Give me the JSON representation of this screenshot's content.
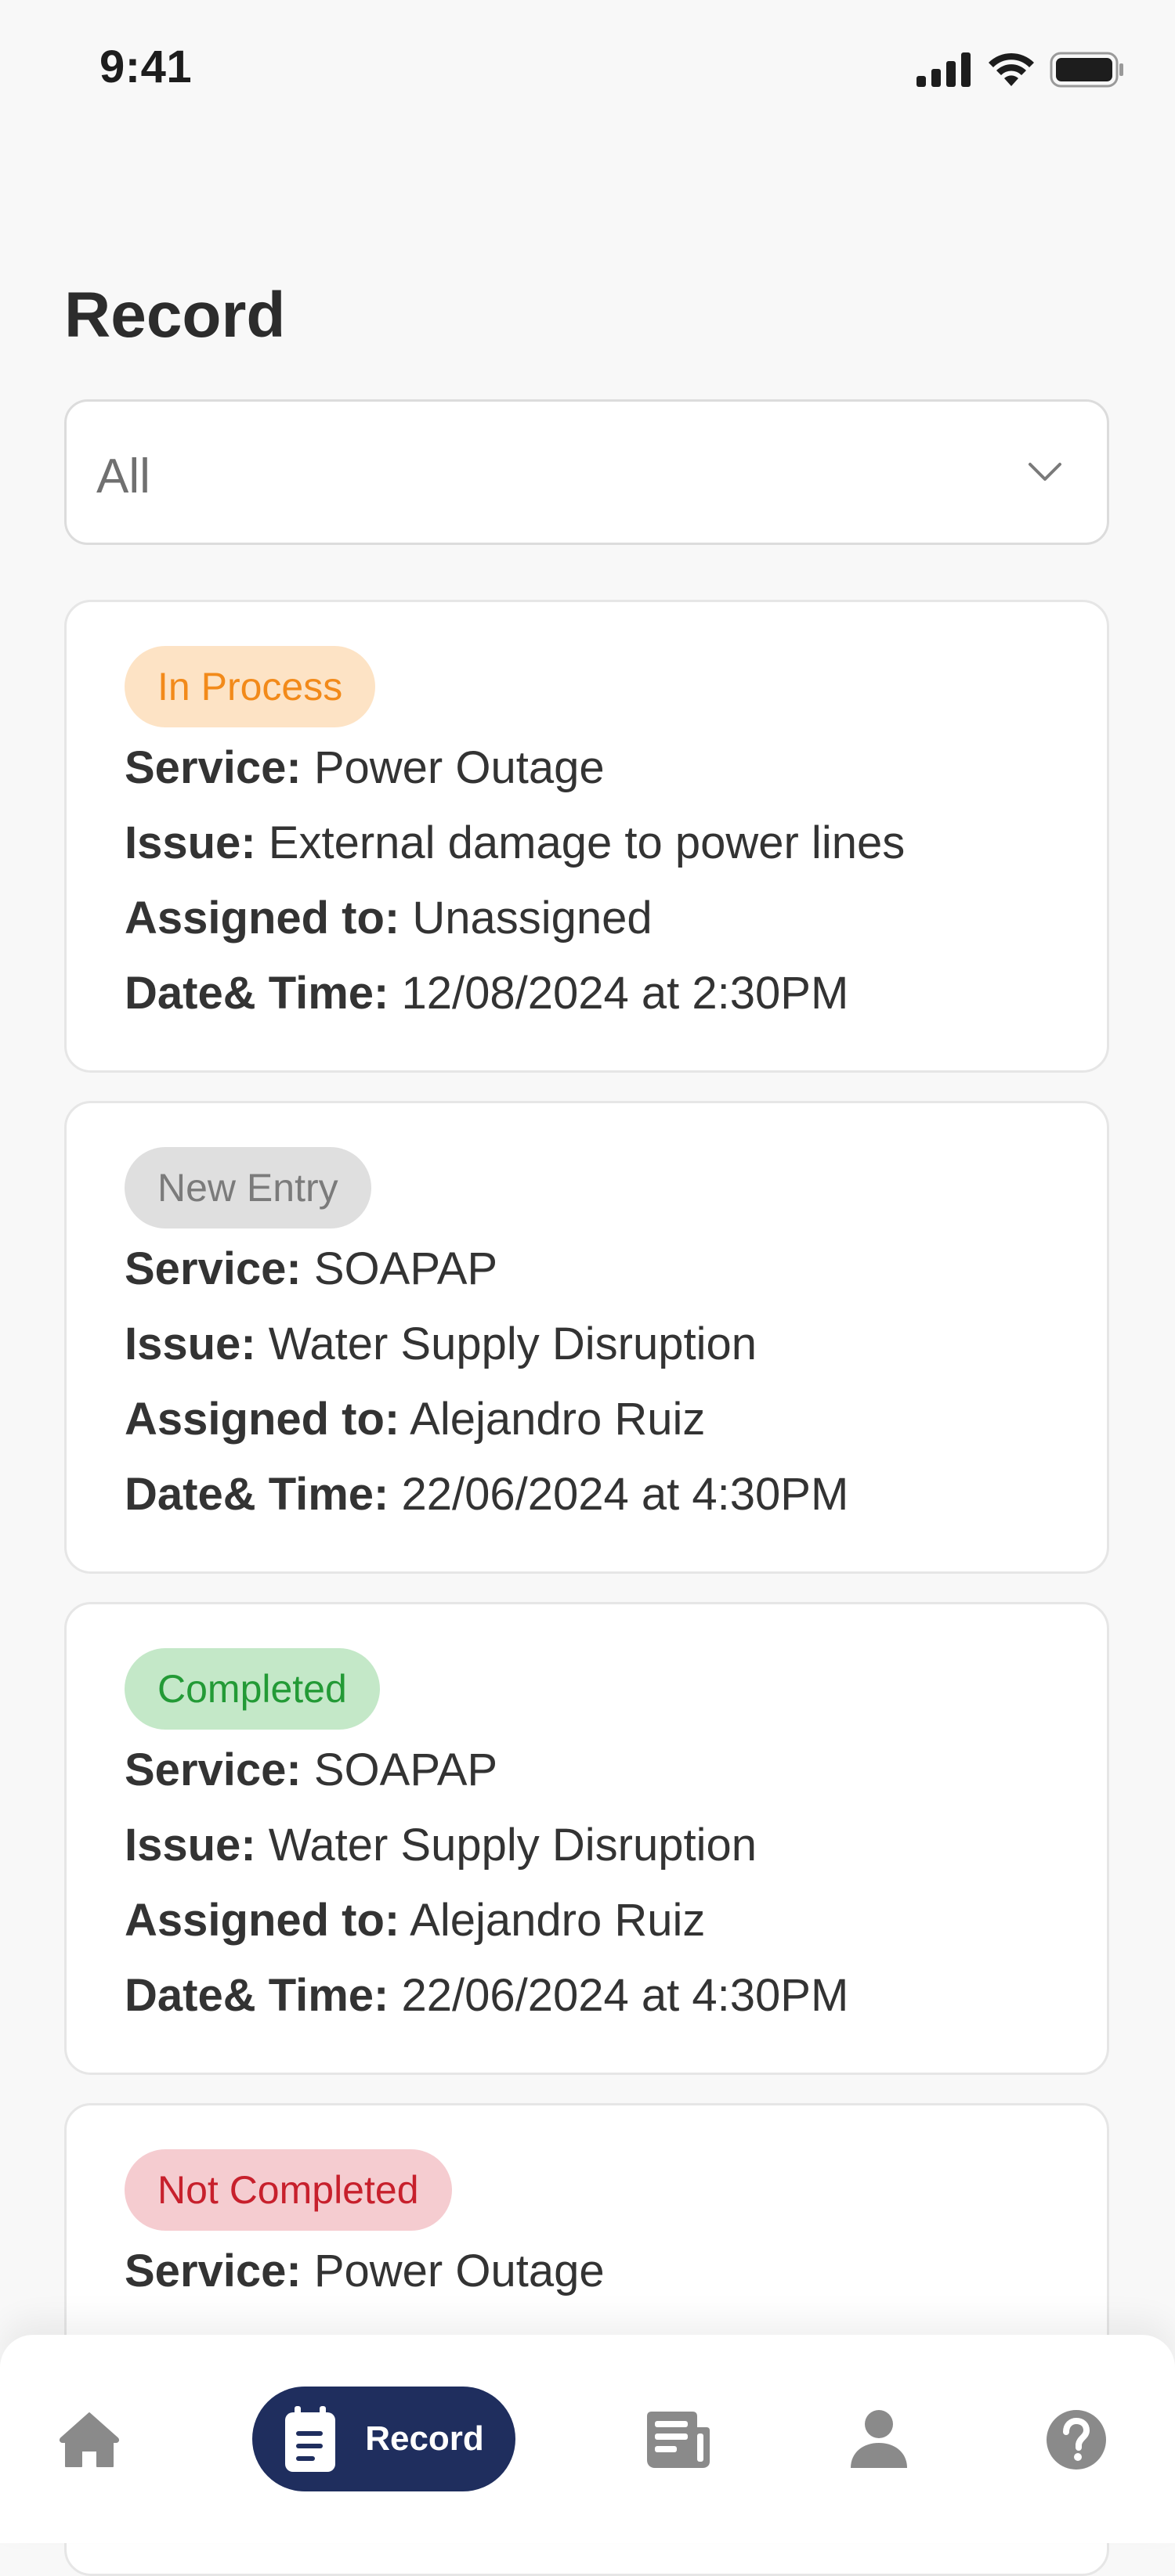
{
  "status_bar": {
    "time": "9:41"
  },
  "page": {
    "title": "Record"
  },
  "filter": {
    "selected": "All"
  },
  "records": [
    {
      "status": "In Process",
      "service_label": "Service:",
      "service": "Power Outage",
      "issue_label": "Issue:",
      "issue": "External damage to power lines",
      "assigned_label": "Assigned to:",
      "assigned": "Unassigned",
      "datetime_label": "Date& Time:",
      "datetime": "12/08/2024 at 2:30PM"
    },
    {
      "status": "New Entry",
      "service_label": "Service:",
      "service": "SOAPAP",
      "issue_label": "Issue:",
      "issue": "Water Supply Disruption",
      "assigned_label": "Assigned to:",
      "assigned": "Alejandro Ruiz",
      "datetime_label": "Date& Time:",
      "datetime": "22/06/2024 at 4:30PM"
    },
    {
      "status": "Completed",
      "service_label": "Service:",
      "service": "SOAPAP",
      "issue_label": "Issue:",
      "issue": "Water Supply Disruption",
      "assigned_label": "Assigned to:",
      "assigned": "Alejandro Ruiz",
      "datetime_label": "Date& Time:",
      "datetime": "22/06/2024 at 4:30PM"
    },
    {
      "status": "Not Completed",
      "service_label": "Service:",
      "service": "Power Outage"
    }
  ],
  "status_colors": {
    "In Process": {
      "bg": "#fde3c5",
      "fg": "#f28a1a"
    },
    "New Entry": {
      "bg": "#dfdfdf",
      "fg": "#7b7b7b"
    },
    "Completed": {
      "bg": "#c4e8c8",
      "fg": "#239a36"
    },
    "Not Completed": {
      "bg": "#f5ccd0",
      "fg": "#c7202c"
    }
  },
  "bottom_nav": {
    "items": [
      {
        "icon": "home-icon"
      },
      {
        "icon": "record-icon",
        "label": "Record",
        "active": true
      },
      {
        "icon": "news-icon"
      },
      {
        "icon": "profile-icon"
      },
      {
        "icon": "help-icon"
      }
    ],
    "active_color": "#1f2e5e"
  }
}
